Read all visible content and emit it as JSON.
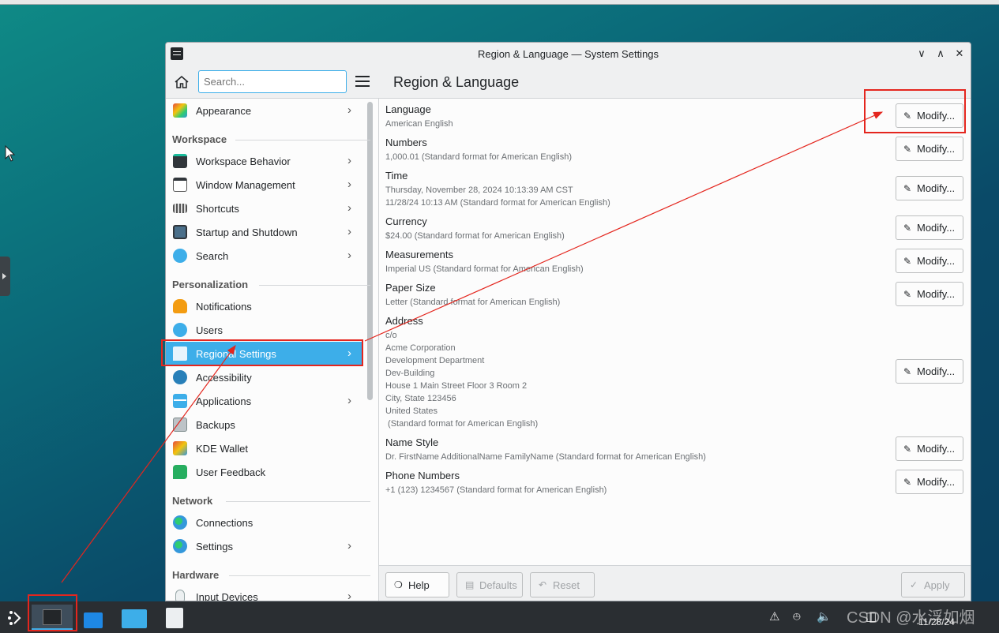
{
  "window": {
    "title": "Region & Language — System Settings",
    "controls": [
      "∨",
      "∧",
      "✕"
    ]
  },
  "sidebar": {
    "search_placeholder": "Search...",
    "items": [
      {
        "label": "Appearance",
        "icon": "appearance-icon"
      },
      {
        "label": "Workspace Behavior",
        "icon": "workspace-behavior-icon"
      },
      {
        "label": "Window Management",
        "icon": "window-management-icon"
      },
      {
        "label": "Shortcuts",
        "icon": "keyboard-icon"
      },
      {
        "label": "Startup and Shutdown",
        "icon": "monitor-icon"
      },
      {
        "label": "Search",
        "icon": "search-icon"
      },
      {
        "label": "Notifications",
        "icon": "bell-icon"
      },
      {
        "label": "Users",
        "icon": "users-icon"
      },
      {
        "label": "Regional Settings",
        "icon": "regional-settings-icon"
      },
      {
        "label": "Accessibility",
        "icon": "accessibility-icon"
      },
      {
        "label": "Applications",
        "icon": "applications-icon"
      },
      {
        "label": "Backups",
        "icon": "backups-icon"
      },
      {
        "label": "KDE Wallet",
        "icon": "wallet-icon"
      },
      {
        "label": "User Feedback",
        "icon": "feedback-icon"
      },
      {
        "label": "Connections",
        "icon": "globe-icon"
      },
      {
        "label": "Settings",
        "icon": "globe-settings-icon"
      },
      {
        "label": "Input Devices",
        "icon": "mouse-icon"
      }
    ],
    "sections": {
      "workspace": "Workspace",
      "personalization": "Personalization",
      "network": "Network",
      "hardware": "Hardware"
    }
  },
  "content": {
    "title": "Region & Language",
    "modify_label": "Modify...",
    "settings": [
      {
        "name": "Language",
        "lines": [
          "American English"
        ]
      },
      {
        "name": "Numbers",
        "lines": [
          "1,000.01 (Standard format for American English)"
        ]
      },
      {
        "name": "Time",
        "lines": [
          "Thursday, November 28, 2024 10:13:39 AM CST",
          "11/28/24 10:13 AM (Standard format for American English)"
        ]
      },
      {
        "name": "Currency",
        "lines": [
          "$24.00 (Standard format for American English)"
        ]
      },
      {
        "name": "Measurements",
        "lines": [
          "Imperial US (Standard format for American English)"
        ]
      },
      {
        "name": "Paper Size",
        "lines": [
          "Letter (Standard format for American English)"
        ]
      },
      {
        "name": "Address",
        "lines": [
          "c/o",
          "Acme Corporation",
          "Development Department",
          "Dev-Building",
          "House 1 Main Street Floor 3 Room 2",
          "City, State 123456",
          "United States",
          " (Standard format for American English)"
        ]
      },
      {
        "name": "Name Style",
        "lines": [
          "Dr. FirstName AdditionalName FamilyName (Standard format for American English)"
        ]
      },
      {
        "name": "Phone Numbers",
        "lines": [
          "+1 (123) 1234567 (Standard format for American English)"
        ]
      }
    ]
  },
  "footer": {
    "help": "Help",
    "defaults": "Defaults",
    "reset": "Reset",
    "apply": "Apply"
  },
  "taskbar": {
    "clock_date": "11/28/24",
    "watermark": "CSDN @水浮如烟"
  },
  "colors": {
    "accent": "#3daee9",
    "annotation": "#e4261e",
    "taskbar": "#2a2e32"
  }
}
